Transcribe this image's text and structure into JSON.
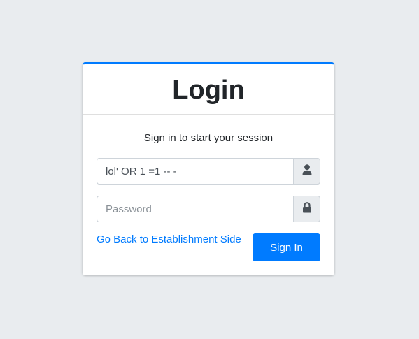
{
  "card": {
    "title": "Login",
    "message": "Sign in to start your session"
  },
  "form": {
    "username": {
      "value": "lol' OR 1 =1 -- -",
      "icon": "user-icon"
    },
    "password": {
      "value": "",
      "placeholder": "Password",
      "icon": "lock-icon"
    },
    "back_link": "Go Back to Establishment Side",
    "submit_label": "Sign In"
  },
  "colors": {
    "accent": "#007bff",
    "background": "#e9ecef"
  }
}
